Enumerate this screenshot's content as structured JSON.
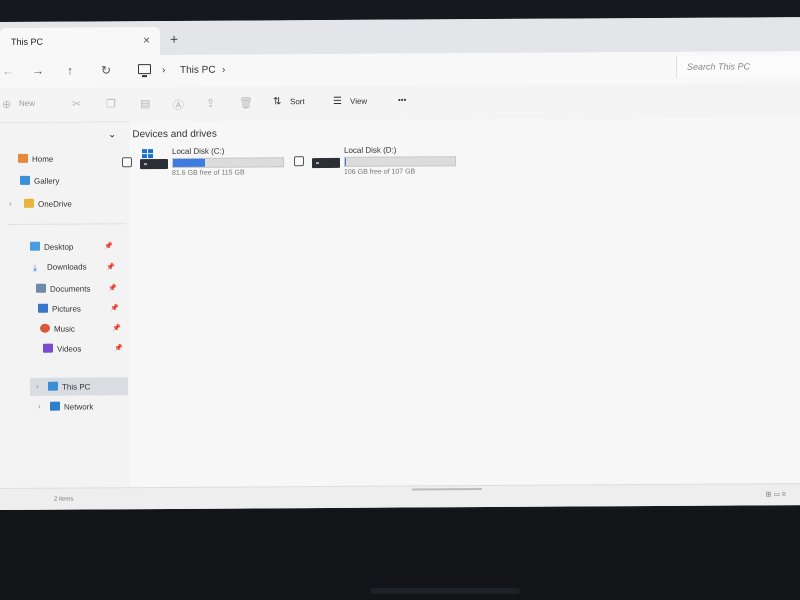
{
  "window": {
    "tab_title": "This PC",
    "tab_close": "×",
    "new_tab": "+"
  },
  "address": {
    "back": "←",
    "forward": "→",
    "up": "↑",
    "refresh": "↻",
    "separator": "›",
    "crumb": "This PC",
    "crumb_chevron": "›",
    "search_placeholder": "Search This PC"
  },
  "toolbar": {
    "new_label": "New",
    "sort_label": "Sort",
    "view_label": "View",
    "more": "•••"
  },
  "sidebar": {
    "home": "Home",
    "gallery": "Gallery",
    "onedrive": "OneDrive",
    "desktop": "Desktop",
    "downloads": "Downloads",
    "documents": "Documents",
    "pictures": "Pictures",
    "music": "Music",
    "videos": "Videos",
    "this_pc": "This PC",
    "network": "Network"
  },
  "main": {
    "section_title": "Devices and drives",
    "section_chevron": "⌄",
    "drives": [
      {
        "name": "Local Disk (C:)",
        "free": "81.6 GB free of 115 GB",
        "used_fraction": 0.29
      },
      {
        "name": "Local Disk (D:)",
        "free": "106 GB free of 107 GB",
        "used_fraction": 0.01
      }
    ]
  },
  "status": {
    "item_count": "2 items"
  },
  "colors": {
    "accent": "#3d7be0",
    "selected_bg": "#d9dde2"
  }
}
